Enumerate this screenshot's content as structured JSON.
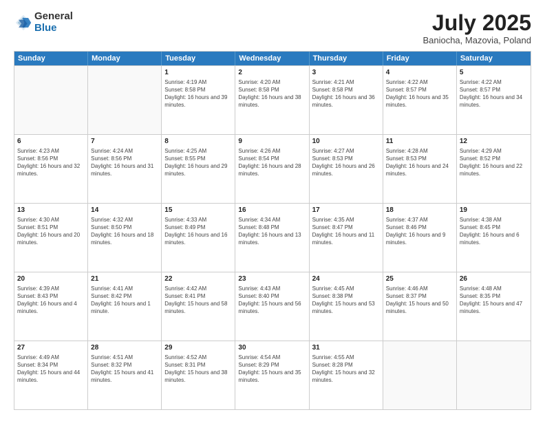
{
  "header": {
    "logo_line1": "General",
    "logo_line2": "Blue",
    "month": "July 2025",
    "location": "Baniocha, Mazovia, Poland"
  },
  "weekdays": [
    "Sunday",
    "Monday",
    "Tuesday",
    "Wednesday",
    "Thursday",
    "Friday",
    "Saturday"
  ],
  "weeks": [
    [
      {
        "day": "",
        "info": ""
      },
      {
        "day": "",
        "info": ""
      },
      {
        "day": "1",
        "info": "Sunrise: 4:19 AM\nSunset: 8:58 PM\nDaylight: 16 hours and 39 minutes."
      },
      {
        "day": "2",
        "info": "Sunrise: 4:20 AM\nSunset: 8:58 PM\nDaylight: 16 hours and 38 minutes."
      },
      {
        "day": "3",
        "info": "Sunrise: 4:21 AM\nSunset: 8:58 PM\nDaylight: 16 hours and 36 minutes."
      },
      {
        "day": "4",
        "info": "Sunrise: 4:22 AM\nSunset: 8:57 PM\nDaylight: 16 hours and 35 minutes."
      },
      {
        "day": "5",
        "info": "Sunrise: 4:22 AM\nSunset: 8:57 PM\nDaylight: 16 hours and 34 minutes."
      }
    ],
    [
      {
        "day": "6",
        "info": "Sunrise: 4:23 AM\nSunset: 8:56 PM\nDaylight: 16 hours and 32 minutes."
      },
      {
        "day": "7",
        "info": "Sunrise: 4:24 AM\nSunset: 8:56 PM\nDaylight: 16 hours and 31 minutes."
      },
      {
        "day": "8",
        "info": "Sunrise: 4:25 AM\nSunset: 8:55 PM\nDaylight: 16 hours and 29 minutes."
      },
      {
        "day": "9",
        "info": "Sunrise: 4:26 AM\nSunset: 8:54 PM\nDaylight: 16 hours and 28 minutes."
      },
      {
        "day": "10",
        "info": "Sunrise: 4:27 AM\nSunset: 8:53 PM\nDaylight: 16 hours and 26 minutes."
      },
      {
        "day": "11",
        "info": "Sunrise: 4:28 AM\nSunset: 8:53 PM\nDaylight: 16 hours and 24 minutes."
      },
      {
        "day": "12",
        "info": "Sunrise: 4:29 AM\nSunset: 8:52 PM\nDaylight: 16 hours and 22 minutes."
      }
    ],
    [
      {
        "day": "13",
        "info": "Sunrise: 4:30 AM\nSunset: 8:51 PM\nDaylight: 16 hours and 20 minutes."
      },
      {
        "day": "14",
        "info": "Sunrise: 4:32 AM\nSunset: 8:50 PM\nDaylight: 16 hours and 18 minutes."
      },
      {
        "day": "15",
        "info": "Sunrise: 4:33 AM\nSunset: 8:49 PM\nDaylight: 16 hours and 16 minutes."
      },
      {
        "day": "16",
        "info": "Sunrise: 4:34 AM\nSunset: 8:48 PM\nDaylight: 16 hours and 13 minutes."
      },
      {
        "day": "17",
        "info": "Sunrise: 4:35 AM\nSunset: 8:47 PM\nDaylight: 16 hours and 11 minutes."
      },
      {
        "day": "18",
        "info": "Sunrise: 4:37 AM\nSunset: 8:46 PM\nDaylight: 16 hours and 9 minutes."
      },
      {
        "day": "19",
        "info": "Sunrise: 4:38 AM\nSunset: 8:45 PM\nDaylight: 16 hours and 6 minutes."
      }
    ],
    [
      {
        "day": "20",
        "info": "Sunrise: 4:39 AM\nSunset: 8:43 PM\nDaylight: 16 hours and 4 minutes."
      },
      {
        "day": "21",
        "info": "Sunrise: 4:41 AM\nSunset: 8:42 PM\nDaylight: 16 hours and 1 minute."
      },
      {
        "day": "22",
        "info": "Sunrise: 4:42 AM\nSunset: 8:41 PM\nDaylight: 15 hours and 58 minutes."
      },
      {
        "day": "23",
        "info": "Sunrise: 4:43 AM\nSunset: 8:40 PM\nDaylight: 15 hours and 56 minutes."
      },
      {
        "day": "24",
        "info": "Sunrise: 4:45 AM\nSunset: 8:38 PM\nDaylight: 15 hours and 53 minutes."
      },
      {
        "day": "25",
        "info": "Sunrise: 4:46 AM\nSunset: 8:37 PM\nDaylight: 15 hours and 50 minutes."
      },
      {
        "day": "26",
        "info": "Sunrise: 4:48 AM\nSunset: 8:35 PM\nDaylight: 15 hours and 47 minutes."
      }
    ],
    [
      {
        "day": "27",
        "info": "Sunrise: 4:49 AM\nSunset: 8:34 PM\nDaylight: 15 hours and 44 minutes."
      },
      {
        "day": "28",
        "info": "Sunrise: 4:51 AM\nSunset: 8:32 PM\nDaylight: 15 hours and 41 minutes."
      },
      {
        "day": "29",
        "info": "Sunrise: 4:52 AM\nSunset: 8:31 PM\nDaylight: 15 hours and 38 minutes."
      },
      {
        "day": "30",
        "info": "Sunrise: 4:54 AM\nSunset: 8:29 PM\nDaylight: 15 hours and 35 minutes."
      },
      {
        "day": "31",
        "info": "Sunrise: 4:55 AM\nSunset: 8:28 PM\nDaylight: 15 hours and 32 minutes."
      },
      {
        "day": "",
        "info": ""
      },
      {
        "day": "",
        "info": ""
      }
    ]
  ]
}
